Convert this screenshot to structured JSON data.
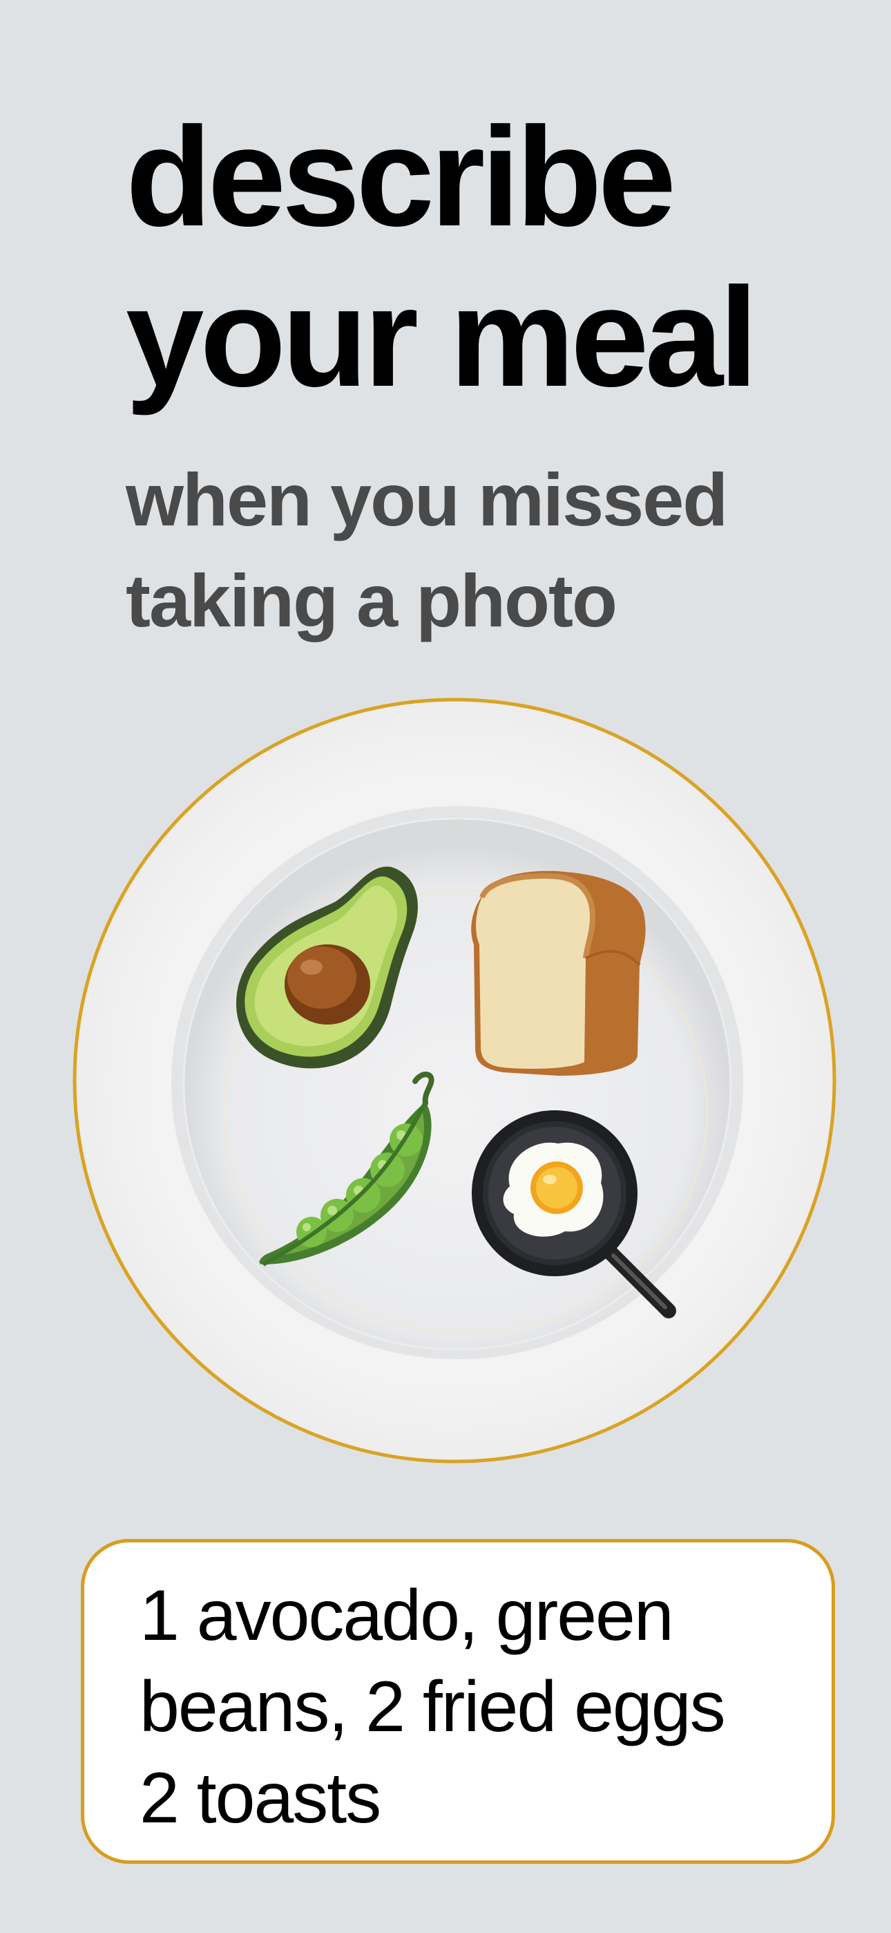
{
  "headline": {
    "line1": "describe",
    "line2": "your meal"
  },
  "subtitle": {
    "line1": "when you missed",
    "line2": "taking a photo"
  },
  "plate": {
    "rim_color": "#d9a323",
    "foods": [
      {
        "icon": "avocado-icon"
      },
      {
        "icon": "bread-icon"
      },
      {
        "icon": "pea-pod-icon"
      },
      {
        "icon": "fried-egg-pan-icon"
      }
    ]
  },
  "meal_input": {
    "line1": "1 avocado,  green",
    "line2": "beans,  2 fried eggs",
    "line3": "2 toasts",
    "border_color": "#d79d1e"
  }
}
